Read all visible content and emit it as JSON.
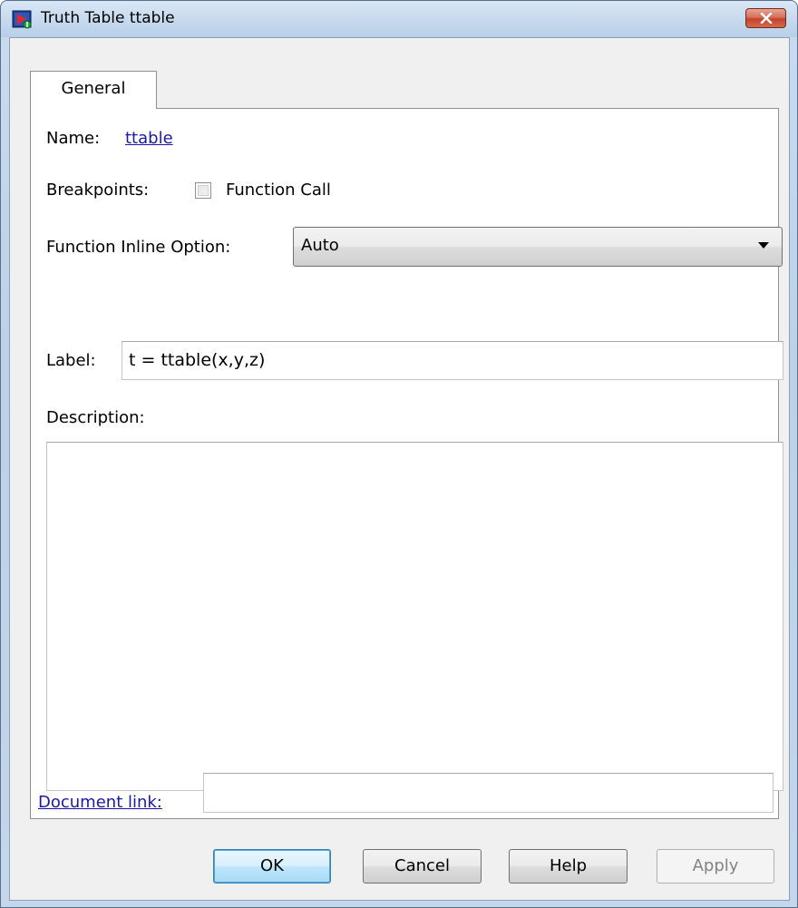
{
  "window": {
    "title": "Truth Table ttable",
    "app_icon": "simulink-truth-table-icon",
    "close_icon": "close-icon"
  },
  "tabs": [
    {
      "label": "General",
      "active": true
    }
  ],
  "general": {
    "name_label": "Name:",
    "name_value": "ttable",
    "breakpoints_label": "Breakpoints:",
    "function_call_label": "Function Call",
    "function_call_checked": false,
    "inline_option_label": "Function Inline Option:",
    "inline_option_value": "Auto",
    "label_label": "Label:",
    "label_value": "t = ttable(x,y,z)",
    "description_label": "Description:",
    "description_value": "",
    "document_link_label": "Document link:",
    "document_link_value": ""
  },
  "buttons": {
    "ok": "OK",
    "cancel": "Cancel",
    "help": "Help",
    "apply": "Apply"
  },
  "colors": {
    "link": "#1a1aa6",
    "close_button": "#c5412a",
    "default_button": "#bee6fd"
  }
}
